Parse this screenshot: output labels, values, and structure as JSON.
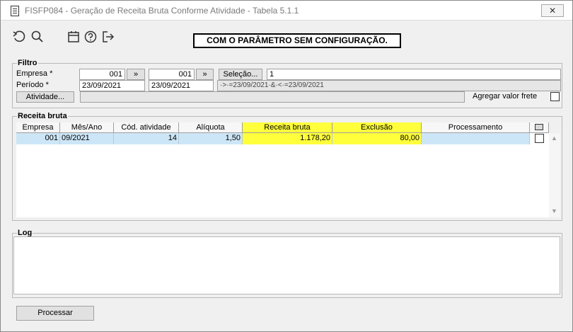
{
  "window": {
    "title": "FISFP084 - Geração de Receita Bruta Conforme Atividade - Tabela 5.1.1",
    "close_label": "✕"
  },
  "toolbar": {
    "icons": [
      "undo-icon",
      "search-icon",
      "calendar-icon",
      "help-icon",
      "exit-icon"
    ],
    "banner": "COM O PARÂMETRO SEM CONFIGURAÇÃO."
  },
  "filtro": {
    "legend": "Filtro",
    "empresa_label": "Empresa *",
    "empresa_from": "001",
    "empresa_to": "001",
    "arrow_label": "»",
    "selecao_label": "Seleção...",
    "selecao_value": "1",
    "periodo_label": "Período *",
    "periodo_from": "23/09/2021",
    "periodo_to": "23/09/2021",
    "periodo_expr": "·>·=23/09/2021·&·<·=23/09/2021",
    "atividade_label": "Atividade...",
    "atividade_value": "",
    "agregar_label": "Agregar valor frete"
  },
  "receita": {
    "legend": "Receita bruta",
    "columns": [
      "Empresa",
      "Mês/Ano",
      "Cód. atividade",
      "Alíquota",
      "Receita bruta",
      "Exclusão",
      "Processamento"
    ],
    "highlight_color": "#ffff3c",
    "rows": [
      {
        "empresa": "001",
        "mes_ano": "09/2021",
        "cod_atividade": "14",
        "aliquota": "1,50",
        "receita_bruta": "1.178,20",
        "exclusao": "80,00",
        "processamento": ""
      }
    ]
  },
  "log": {
    "legend": "Log",
    "text": ""
  },
  "footer": {
    "processar_label": "Processar"
  }
}
